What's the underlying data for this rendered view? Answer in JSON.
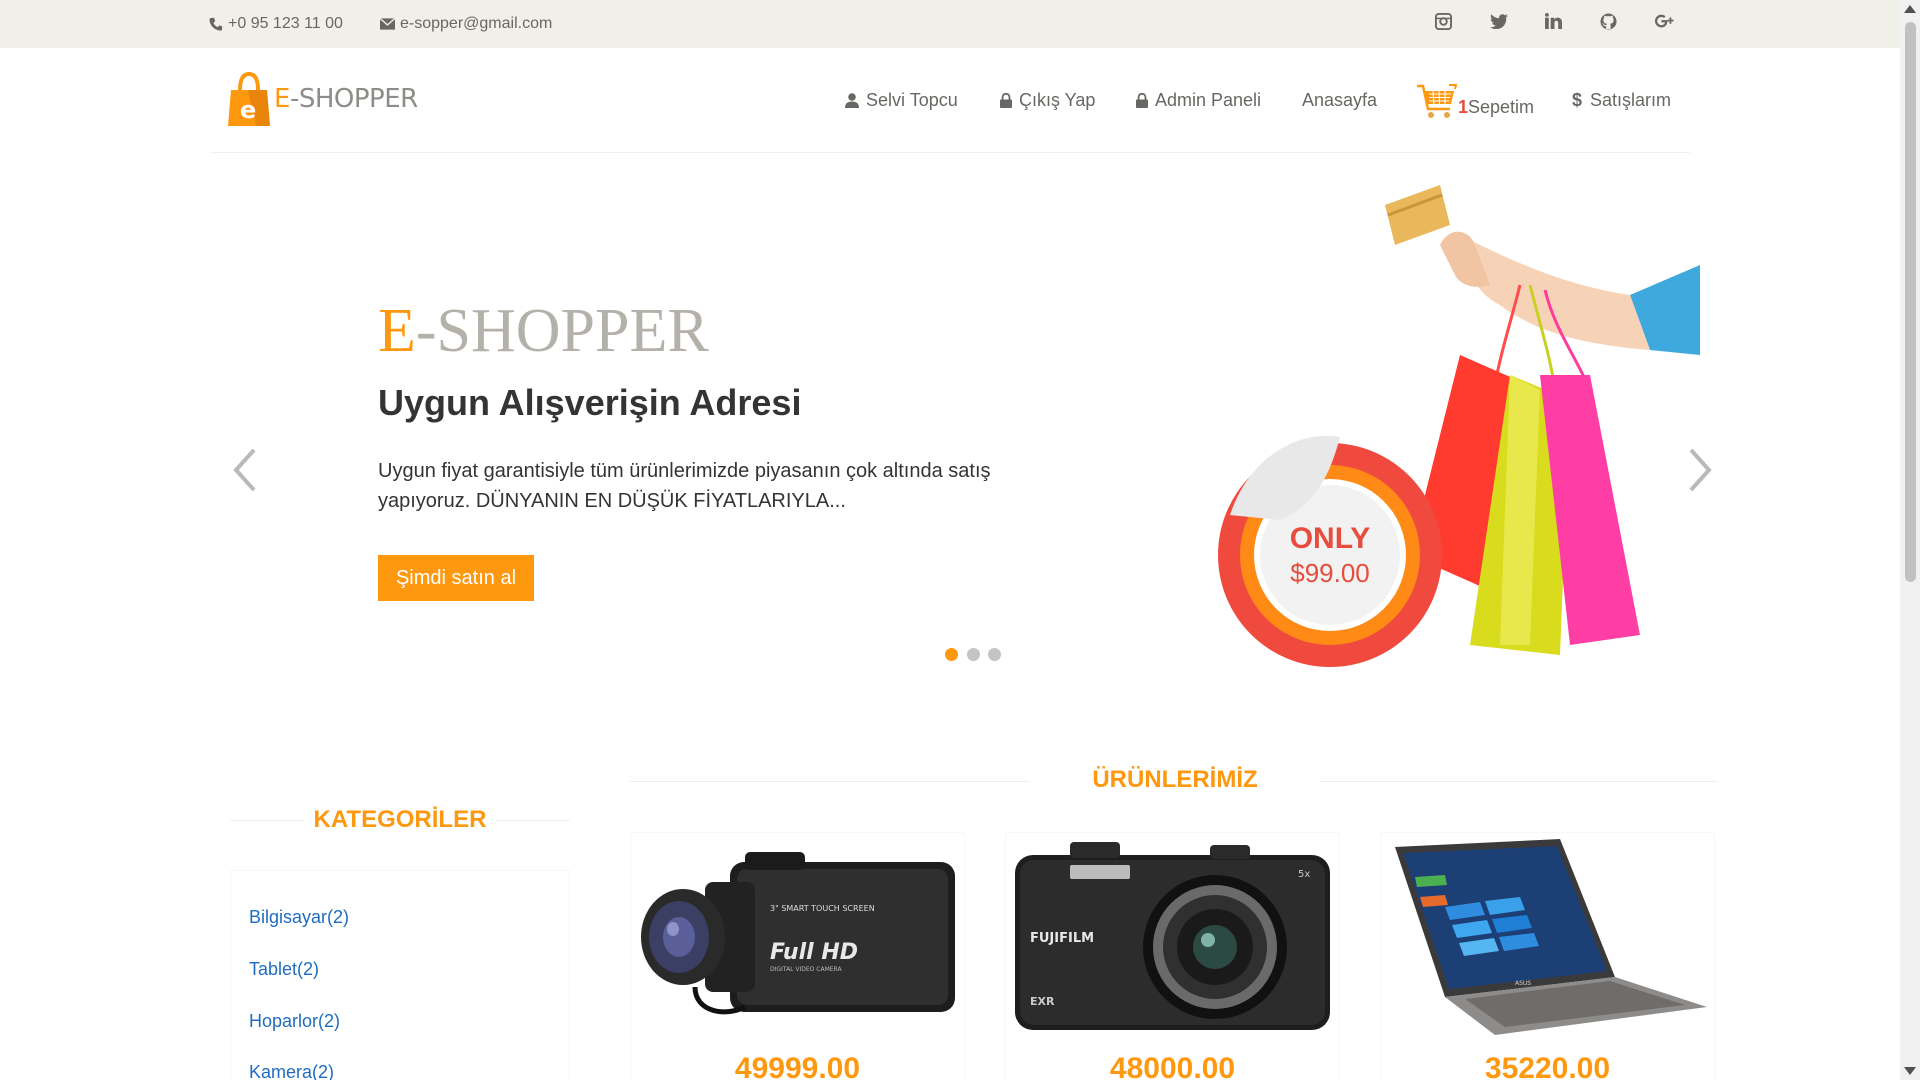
{
  "topbar": {
    "phone": "+0 95 123 11 00",
    "email": "e-sopper@gmail.com",
    "social_icons": [
      "instagram-icon",
      "twitter-icon",
      "linkedin-icon",
      "github-icon",
      "google-plus-icon"
    ]
  },
  "header": {
    "logo_e": "E",
    "logo_rest": "-SHOPPER",
    "nav": {
      "user": "Selvi Topcu",
      "logout": "Çıkış Yap",
      "admin": "Admin Paneli",
      "home": "Anasayfa",
      "cart_count": "1",
      "cart": "Sepetim",
      "sales": "Satışlarım"
    }
  },
  "slider": {
    "brand_e": "E",
    "brand_rest": "-SHOPPER",
    "subtitle": "Uygun Alışverişin Adresi",
    "description": "Uygun fiyat garantisiyle tüm ürünlerimizde piyasanın çok altında satış yapıyoruz. DÜNYANIN EN DÜŞÜK FİYATLARIYLA...",
    "button": "Şimdi satın al",
    "badge_top": "ONLY",
    "badge_price": "$99.00",
    "dots": 3,
    "active_dot": 0
  },
  "categories": {
    "title": "KATEGORİLER",
    "items": [
      "Bilgisayar(2)",
      "Tablet(2)",
      "Hoparlor(2)",
      "Kamera(2)"
    ]
  },
  "products": {
    "title": "ÜRÜNLERİMİZ",
    "items": [
      {
        "price": "49999.00",
        "image": "camcorder",
        "label": "Full HD"
      },
      {
        "price": "48000.00",
        "image": "digital-camera",
        "label": "FUJIFILM"
      },
      {
        "price": "35220.00",
        "image": "laptop",
        "label": "ASUS"
      }
    ]
  },
  "colors": {
    "accent": "#fe980f",
    "topbar_bg": "#f0f0e9",
    "link": "#1f6cc0"
  }
}
